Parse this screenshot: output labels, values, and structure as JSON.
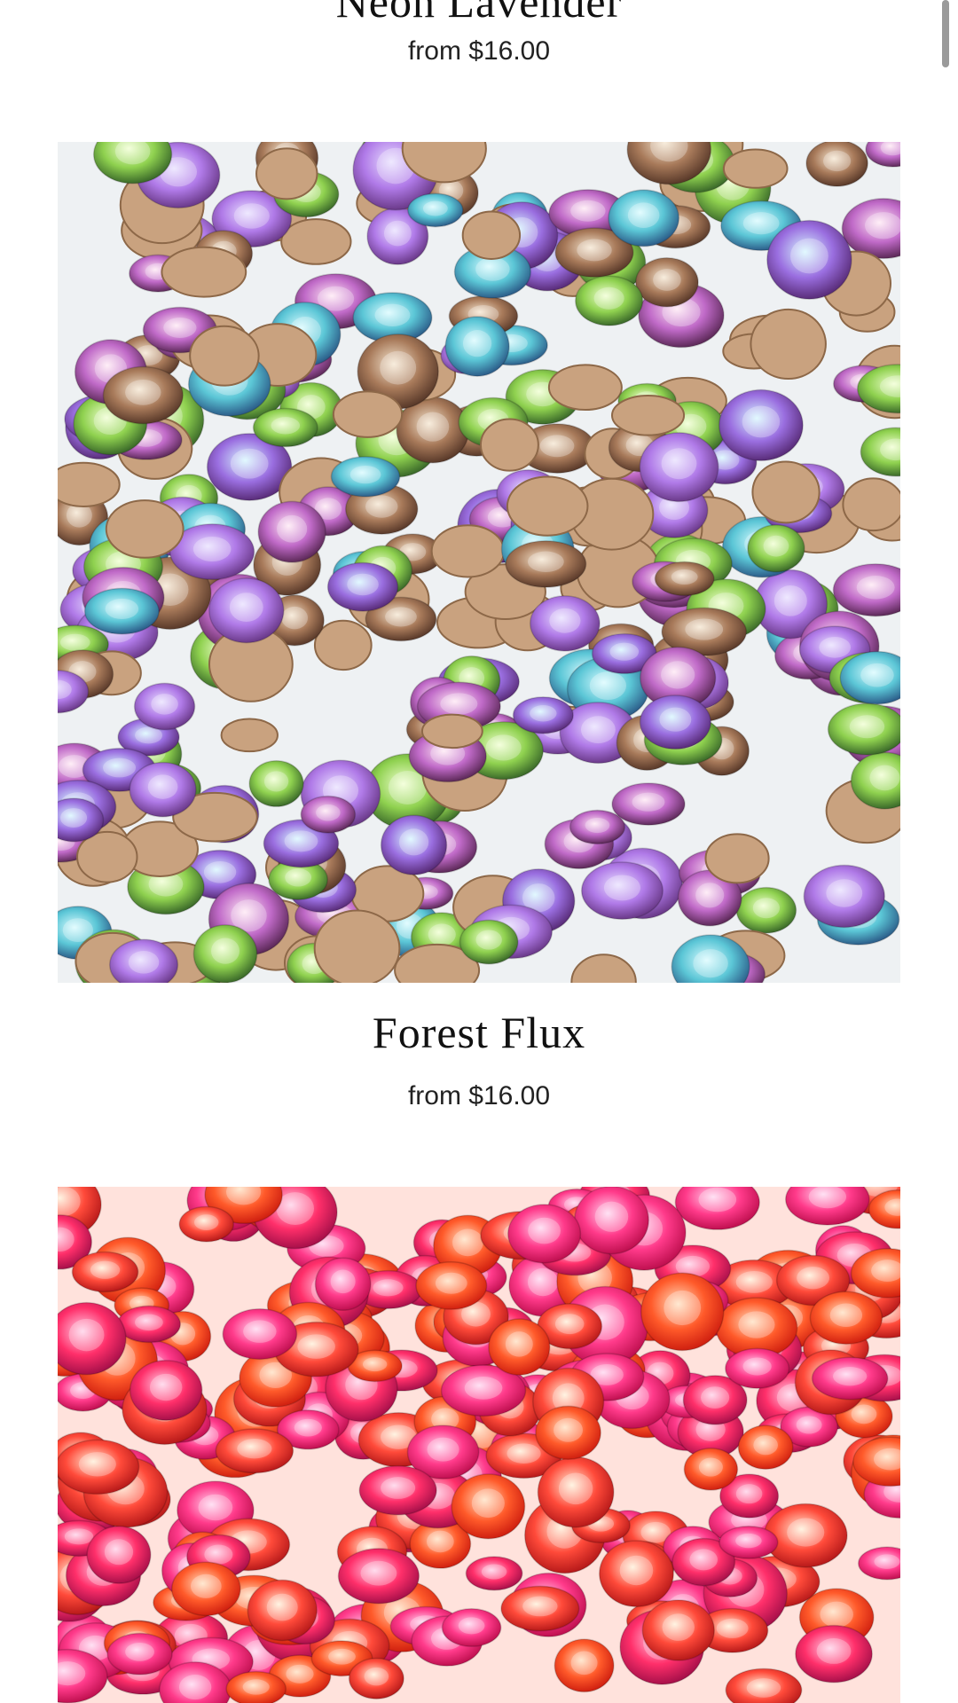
{
  "products": [
    {
      "title": "Neon Lavender",
      "price": "from $16.00"
    },
    {
      "title": "Forest Flux",
      "price": "from $16.00"
    },
    {
      "title": "",
      "price": ""
    }
  ],
  "colors": {
    "background": "#ffffff",
    "text": "#111111",
    "scrollbar": "#9a9a9a"
  }
}
